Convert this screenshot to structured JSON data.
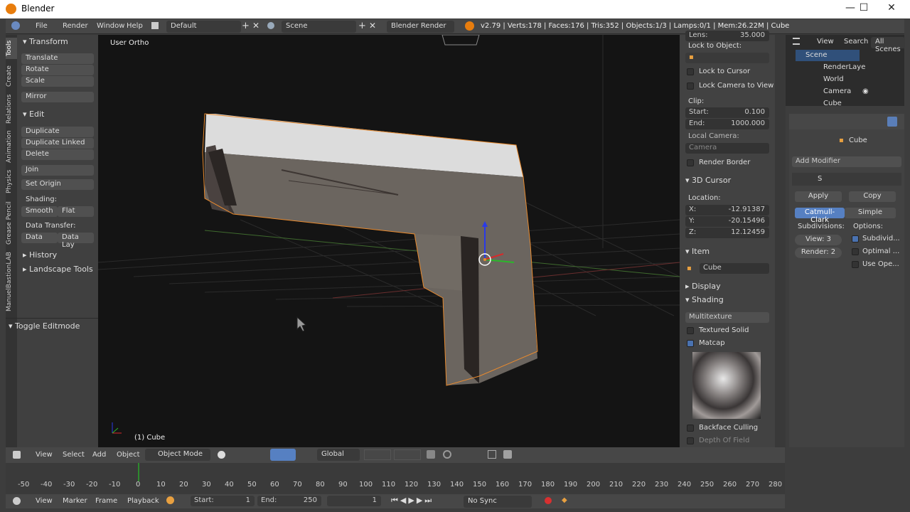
{
  "window": {
    "title": "Blender",
    "minimize": "—",
    "maximize": "☐",
    "close": "✕"
  },
  "infobar": {
    "menus": [
      "File",
      "Render",
      "Window",
      "Help"
    ],
    "layout": "Default",
    "scene": "Scene",
    "engine": "Blender Render",
    "stats": "v2.79 | Verts:178 | Faces:176 | Tris:352 | Objects:1/3 | Lamps:0/1 | Mem:26.22M | Cube"
  },
  "tabs": [
    "Tools",
    "Create",
    "Relations",
    "Animation",
    "Physics",
    "Grease Pencil",
    "ManuelBastionLAB"
  ],
  "toolshelf": {
    "transform_hd": "Transform",
    "translate": "Translate",
    "rotate": "Rotate",
    "scale": "Scale",
    "mirror": "Mirror",
    "edit_hd": "Edit",
    "duplicate": "Duplicate",
    "duplicate_linked": "Duplicate Linked",
    "delete": "Delete",
    "join": "Join",
    "set_origin": "Set Origin",
    "shading": "Shading:",
    "smooth": "Smooth",
    "flat": "Flat",
    "data_transfer": "Data Transfer:",
    "data": "Data",
    "data_lay": "Data Lay",
    "history": "History",
    "landscape": "Landscape Tools",
    "toggle_editmode": "Toggle Editmode"
  },
  "viewport": {
    "view_label": "User Ortho",
    "object_label": "(1) Cube"
  },
  "props": {
    "lens": "Lens:",
    "lens_val": "35.000",
    "lock_object": "Lock to Object:",
    "lock_cursor": "Lock to Cursor",
    "lock_camera": "Lock Camera to View",
    "clip": "Clip:",
    "start": "Start:",
    "start_val": "0.100",
    "end": "End:",
    "end_val": "1000.000",
    "local_camera": "Local Camera:",
    "camera": "Camera",
    "render_border": "Render Border",
    "cursor_hd": "3D Cursor",
    "location": "Location:",
    "x": "X:",
    "x_val": "-12.91387",
    "y": "Y:",
    "y_val": "-20.15496",
    "z": "Z:",
    "z_val": "12.12459",
    "item_hd": "Item",
    "item_name": "Cube",
    "display_hd": "Display",
    "shading_hd": "Shading",
    "multitexture": "Multitexture",
    "textured_solid": "Textured Solid",
    "matcap": "Matcap",
    "backface": "Backface Culling",
    "depth": "Depth Of Field"
  },
  "outliner": {
    "view": "View",
    "search": "Search",
    "all_scenes": "All Scenes",
    "items": [
      "Scene",
      "RenderLaye",
      "World",
      "Camera",
      "Cube"
    ]
  },
  "modifier": {
    "object": "Cube",
    "add_modifier": "Add Modifier",
    "apply": "Apply",
    "copy": "Copy",
    "catmull": "Catmull-Clark",
    "simple": "Simple",
    "subdivisions": "Subdivisions:",
    "options": "Options:",
    "view": "View: 3",
    "render": "Render: 2",
    "subdivid": "Subdivid...",
    "optimal": "Optimal ...",
    "use_open": "Use Ope..."
  },
  "vpheader": {
    "view": "View",
    "select": "Select",
    "add": "Add",
    "object": "Object",
    "mode": "Object Mode",
    "orientation": "Global"
  },
  "timeline_ticks": [
    "-50",
    "-40",
    "-30",
    "-20",
    "-10",
    "0",
    "10",
    "20",
    "30",
    "40",
    "50",
    "60",
    "70",
    "80",
    "90",
    "100",
    "110",
    "120",
    "130",
    "140",
    "150",
    "160",
    "170",
    "180",
    "190",
    "200",
    "210",
    "220",
    "230",
    "240",
    "250",
    "260",
    "270",
    "280"
  ],
  "tlheader": {
    "view": "View",
    "marker": "Marker",
    "frame": "Frame",
    "playback": "Playback",
    "start": "Start:",
    "start_val": "1",
    "end": "End:",
    "end_val": "250",
    "current": "1",
    "sync": "No Sync"
  }
}
